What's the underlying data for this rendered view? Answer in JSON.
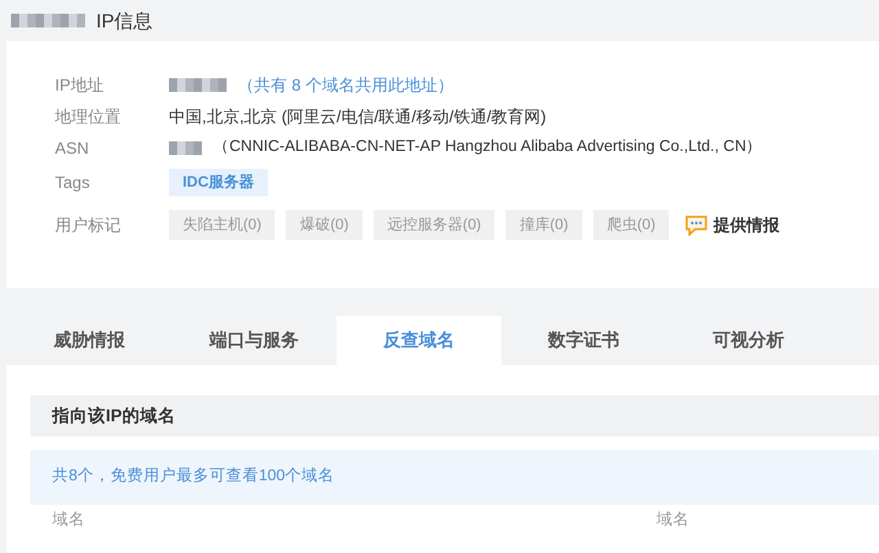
{
  "page_title": "IP信息",
  "info": [
    {
      "label": "IP地址",
      "kind": "ip",
      "value": "（共有 8 个域名共用此地址）"
    },
    {
      "label": "地理位置",
      "kind": "text",
      "value": "中国,北京,北京 (阿里云/电信/联通/移动/铁通/教育网)"
    },
    {
      "label": "ASN",
      "kind": "asn",
      "value": "（CNNIC-ALIBABA-CN-NET-AP Hangzhou Alibaba Advertising Co.,Ltd., CN）"
    },
    {
      "label": "Tags",
      "kind": "tags",
      "tags": [
        "IDC服务器"
      ]
    },
    {
      "label": "用户标记",
      "kind": "marks",
      "marks": [
        "失陷主机(0)",
        "爆破(0)",
        "远控服务器(0)",
        "撞库(0)",
        "爬虫(0)"
      ],
      "action": "提供情报"
    }
  ],
  "tabs": [
    {
      "label": "威胁情报",
      "selected": false
    },
    {
      "label": "端口与服务",
      "selected": false
    },
    {
      "label": "反查域名",
      "selected": true
    },
    {
      "label": "数字证书",
      "selected": false
    },
    {
      "label": "可视分析",
      "selected": false
    }
  ],
  "section_title": "指向该IP的域名",
  "notice": "共8个，免费用户最多可查看100个域名",
  "table": {
    "columns": [
      "域名",
      "域名"
    ]
  }
}
